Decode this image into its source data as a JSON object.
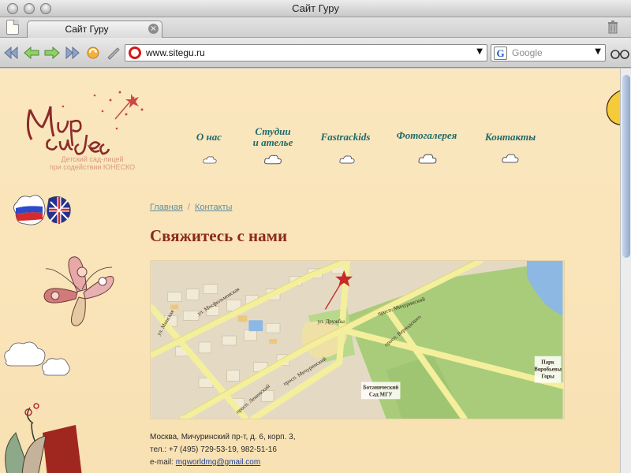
{
  "window": {
    "title": "Сайт Гуру"
  },
  "tabs": [
    {
      "label": "Сайт Гуру"
    }
  ],
  "toolbar": {
    "url": "www.sitegu.ru",
    "search_placeholder": "Google"
  },
  "site": {
    "logo_text": "Мир чудес",
    "logo_subtitle_1": "Детский сад-лицей",
    "logo_subtitle_2": "при содействии ЮНЕСКО",
    "nav": [
      {
        "line1": "О нас",
        "line2": ""
      },
      {
        "line1": "Студии",
        "line2": "и ателье"
      },
      {
        "line1": "Fastrackids",
        "line2": ""
      },
      {
        "line1": "Фотогалерея",
        "line2": ""
      },
      {
        "line1": "Контакты",
        "line2": ""
      }
    ]
  },
  "breadcrumb": {
    "home": "Главная",
    "current": "Контакты",
    "separator": "/"
  },
  "page": {
    "title": "Свяжитесь с нами"
  },
  "map": {
    "labels": {
      "street1": "ул. Мосфильмовская",
      "street2": "просп. Мичуринский",
      "street3": "просп. Мичуринский",
      "street4": "ул. Минская",
      "street5": "просп. Ленинский",
      "street6": "ул. Дружбы",
      "street7": "просп. Вернадского",
      "park1": "Ботанический",
      "park2": "Сад МГУ",
      "park3": "Парк",
      "park4": "Воробьевы",
      "park5": "Горы"
    },
    "colors": {
      "park": "#a9cc7a",
      "road": "#f4ef9c",
      "water": "#8cb8e3",
      "blocks": "#dcd1b8"
    }
  },
  "contacts": {
    "address": "Москва, Мичуринский пр-т, д. 6, корп. 3,",
    "phone": "тел.: +7 (495) 729-53-19, 982-51-16",
    "email_label": "e-mail: ",
    "email": "mgworldmg@gmail.com"
  }
}
